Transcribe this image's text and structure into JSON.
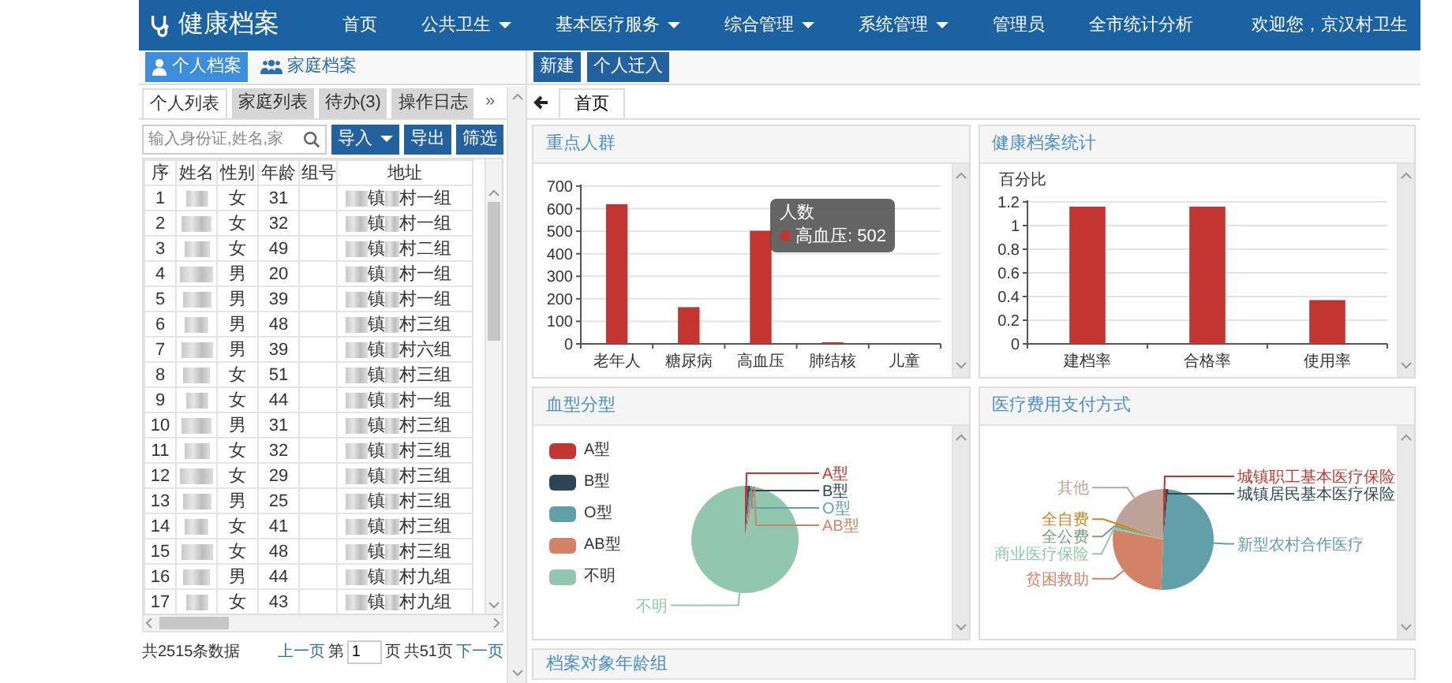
{
  "app": {
    "title": "健康档案"
  },
  "nav": [
    {
      "label": "首页",
      "dropdown": false
    },
    {
      "label": "公共卫生",
      "dropdown": true
    },
    {
      "label": "基本医疗服务",
      "dropdown": true
    },
    {
      "label": "综合管理",
      "dropdown": true
    },
    {
      "label": "系统管理",
      "dropdown": true
    },
    {
      "label": "管理员",
      "dropdown": false
    },
    {
      "label": "全市统计分析",
      "dropdown": false
    }
  ],
  "user_greeting": "欢迎您，京汉村卫生",
  "left": {
    "archive_tabs": [
      {
        "label": "个人档案",
        "kind": "person",
        "selected": true
      },
      {
        "label": "家庭档案",
        "kind": "family",
        "selected": false
      }
    ],
    "list_tabs": [
      {
        "label": "个人列表",
        "selected": true
      },
      {
        "label": "家庭列表",
        "selected": false
      },
      {
        "label": "待办(3)",
        "selected": false
      },
      {
        "label": "操作日志",
        "selected": false
      }
    ],
    "more": "»",
    "search": {
      "placeholder": "输入身份证,姓名,家"
    },
    "actions": [
      {
        "label": "导入",
        "dropdown": true
      },
      {
        "label": "导出",
        "dropdown": false
      },
      {
        "label": "筛选",
        "dropdown": false
      }
    ],
    "table": {
      "columns": [
        "序",
        "姓名",
        "性别",
        "年龄",
        "组号",
        "地址"
      ],
      "rows": [
        {
          "no": "1",
          "sex": "女",
          "age": "31",
          "town": "镇",
          "village": "村一组"
        },
        {
          "no": "2",
          "sex": "女",
          "age": "32",
          "town": "镇",
          "village": "村一组"
        },
        {
          "no": "3",
          "sex": "女",
          "age": "49",
          "town": "镇",
          "village": "村二组"
        },
        {
          "no": "4",
          "sex": "男",
          "age": "20",
          "town": "镇",
          "village": "村一组"
        },
        {
          "no": "5",
          "sex": "男",
          "age": "39",
          "town": "镇",
          "village": "村一组"
        },
        {
          "no": "6",
          "sex": "男",
          "age": "48",
          "town": "镇",
          "village": "村三组"
        },
        {
          "no": "7",
          "sex": "男",
          "age": "39",
          "town": "镇",
          "village": "村六组"
        },
        {
          "no": "8",
          "sex": "女",
          "age": "51",
          "town": "镇",
          "village": "村三组"
        },
        {
          "no": "9",
          "sex": "女",
          "age": "44",
          "town": "镇",
          "village": "村一组"
        },
        {
          "no": "10",
          "sex": "男",
          "age": "31",
          "town": "镇",
          "village": "村三组"
        },
        {
          "no": "11",
          "sex": "女",
          "age": "32",
          "town": "镇",
          "village": "村三组"
        },
        {
          "no": "12",
          "sex": "女",
          "age": "29",
          "town": "镇",
          "village": "村三组"
        },
        {
          "no": "13",
          "sex": "男",
          "age": "25",
          "town": "镇",
          "village": "村三组"
        },
        {
          "no": "14",
          "sex": "女",
          "age": "41",
          "town": "镇",
          "village": "村三组"
        },
        {
          "no": "15",
          "sex": "女",
          "age": "48",
          "town": "镇",
          "village": "村三组"
        },
        {
          "no": "16",
          "sex": "男",
          "age": "44",
          "town": "镇",
          "village": "村九组"
        },
        {
          "no": "17",
          "sex": "女",
          "age": "43",
          "town": "镇",
          "village": "村九组"
        }
      ]
    },
    "footer": {
      "total": "共2515条数据",
      "prev": "上一页",
      "page_label": "第",
      "page_value": "1",
      "page_unit": "页",
      "page_count": "共51页",
      "next": "下一页"
    }
  },
  "right": {
    "toolbar": [
      "新建",
      "个人迁入"
    ],
    "tabs": [
      {
        "label": "首页",
        "selected": true
      }
    ],
    "cards": [
      {
        "title": "重点人群",
        "chart_data": {
          "type": "bar",
          "categories": [
            "老年人",
            "糖尿病",
            "高血压",
            "肺结核",
            "儿童"
          ],
          "series": [
            {
              "name": "人数",
              "color": "#c23531",
              "values": [
                620,
                163,
                502,
                3,
                0
              ]
            }
          ],
          "ylim": [
            0,
            700
          ],
          "yticks": [
            0,
            100,
            200,
            300,
            400,
            500,
            600,
            700
          ],
          "grid": true
        },
        "tooltip": {
          "text": "高血压: 502"
        }
      },
      {
        "title": "健康档案统计",
        "chart_data": {
          "type": "bar",
          "ylabel": "百分比",
          "categories": [
            "建档率",
            "合格率",
            "使用率"
          ],
          "series": [
            {
              "color": "#c23531",
              "values": [
                1.16,
                1.16,
                0.37
              ]
            }
          ],
          "ylim": [
            0,
            1.2
          ],
          "yticks": [
            0,
            0.2,
            0.4,
            0.6,
            0.8,
            1,
            1.2
          ],
          "grid": true
        }
      },
      {
        "title": "血型分型",
        "legend": [
          {
            "label": "A型",
            "color": "#c23531"
          },
          {
            "label": "B型",
            "color": "#2f4554"
          },
          {
            "label": "O型",
            "color": "#61a0a8"
          },
          {
            "label": "AB型",
            "color": "#d48265"
          },
          {
            "label": "不明",
            "color": "#91c7ae"
          }
        ],
        "chart_data": {
          "type": "pie",
          "categories": [
            "A型",
            "B型",
            "O型",
            "AB型",
            "不明"
          ],
          "values": [
            0.8,
            0.6,
            0.8,
            1,
            96.8
          ],
          "colors": [
            "#c23531",
            "#2f4554",
            "#61a0a8",
            "#d48265",
            "#91c7ae"
          ]
        }
      },
      {
        "title": "医疗费用支付方式",
        "chart_data": {
          "type": "pie",
          "categories": [
            "城镇职工基本医疗保险",
            "城镇居民基本医疗保险",
            "新型农村合作医疗",
            "贫困救助",
            "商业医疗保险",
            "全公费",
            "全自费",
            "其他"
          ],
          "values": [
            0.8,
            0.8,
            49,
            27.5,
            0.8,
            0.8,
            1,
            19.3
          ],
          "colors": [
            "#c23531",
            "#2f4554",
            "#61a0a8",
            "#d48265",
            "#91c7ae",
            "#749f83",
            "#ca8622",
            "#bda29a"
          ]
        }
      },
      {
        "title": "档案对象年龄组"
      }
    ]
  }
}
